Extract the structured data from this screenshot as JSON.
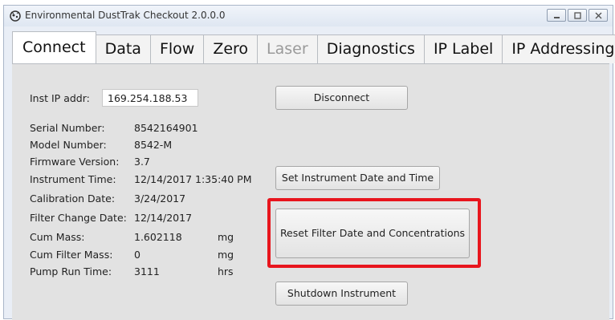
{
  "window": {
    "title": "Environmental DustTrak Checkout   2.0.0.0"
  },
  "tabs": [
    {
      "label": "Connect",
      "state": "active"
    },
    {
      "label": "Data",
      "state": "normal"
    },
    {
      "label": "Flow",
      "state": "normal"
    },
    {
      "label": "Zero",
      "state": "normal"
    },
    {
      "label": "Laser",
      "state": "disabled"
    },
    {
      "label": "Diagnostics",
      "state": "normal"
    },
    {
      "label": "IP Label",
      "state": "normal"
    },
    {
      "label": "IP Addressing",
      "state": "normal"
    }
  ],
  "connect": {
    "ip_label": "Inst IP addr:",
    "ip_value": "169.254.188.53",
    "fields": [
      {
        "label": "Serial Number:",
        "value": "8542164901",
        "unit": ""
      },
      {
        "label": "Model Number:",
        "value": "8542-M",
        "unit": ""
      },
      {
        "label": "Firmware Version:",
        "value": "3.7",
        "unit": ""
      },
      {
        "label": "Instrument Time:",
        "value": "12/14/2017 1:35:40 PM",
        "unit": ""
      },
      {
        "label": "Calibration Date:",
        "value": "3/24/2017",
        "unit": ""
      },
      {
        "label": "Filter Change Date:",
        "value": "12/14/2017",
        "unit": ""
      },
      {
        "label": "Cum Mass:",
        "value": "1.602118",
        "unit": "mg"
      },
      {
        "label": "Cum Filter Mass:",
        "value": "0",
        "unit": "mg"
      },
      {
        "label": "Pump Run Time:",
        "value": "3111",
        "unit": "hrs"
      }
    ],
    "buttons": {
      "disconnect": "Disconnect",
      "set_time": "Set Instrument Date and Time",
      "reset_filter": "Reset Filter Date and Concentrations",
      "shutdown": "Shutdown Instrument"
    }
  },
  "colors": {
    "highlight": "#e8151d",
    "panel": "#e2e2e2"
  }
}
